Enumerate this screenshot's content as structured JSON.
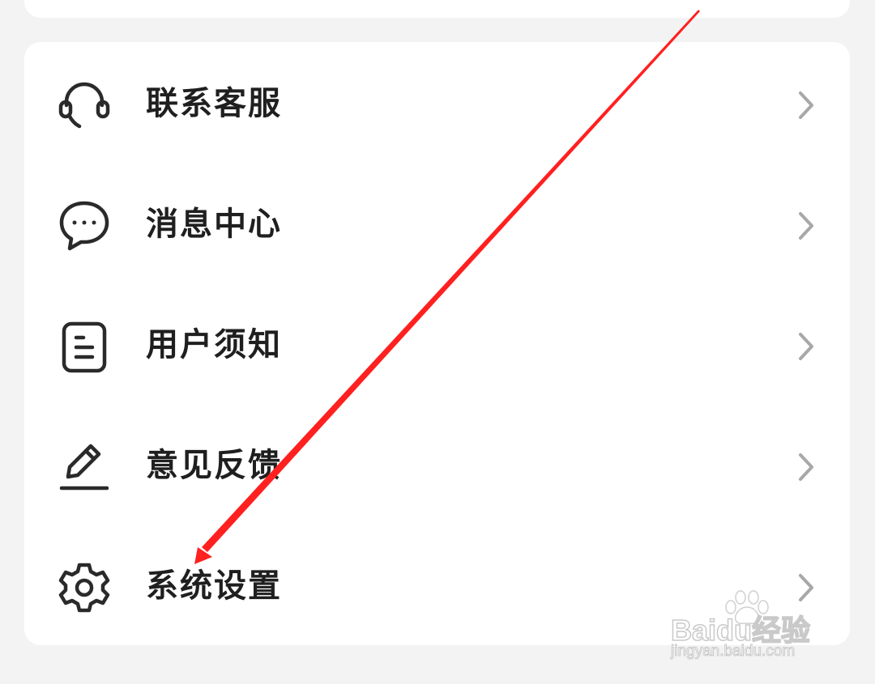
{
  "menu": {
    "items": [
      {
        "label": "联系客服",
        "icon": "headset-icon"
      },
      {
        "label": "消息中心",
        "icon": "chat-bubble-icon"
      },
      {
        "label": "用户须知",
        "icon": "document-icon"
      },
      {
        "label": "意见反馈",
        "icon": "pencil-icon"
      },
      {
        "label": "系统设置",
        "icon": "gear-icon"
      }
    ]
  },
  "annotation": {
    "arrow_color": "#ff2020"
  },
  "watermark": {
    "brand": "Baidu经验",
    "url": "jingyan.baidu.com"
  },
  "colors": {
    "background": "#f3f3f3",
    "card": "#ffffff",
    "text": "#1f1f1f",
    "chevron": "#a8a8a8",
    "icon": "#2a2a2a"
  }
}
